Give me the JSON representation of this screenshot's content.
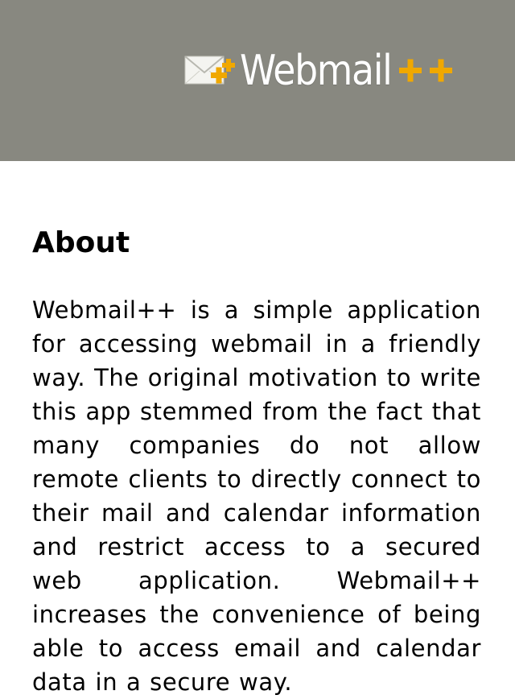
{
  "header": {
    "logo_text": "Webmail",
    "logo_accent": "++",
    "background_color": "#888880",
    "accent_color": "#f0a800",
    "icon": "envelope-plus-icon"
  },
  "about": {
    "title": "About",
    "body": "Webmail++ is a simple application for accessing webmail in a friendly way. The original motivation to write this app stemmed from the fact that many companies do not allow remote clients to directly connect to their mail and calendar information and restrict access to a secured web application. Webmail++ increases the convenience of being able to access email and calendar data in a secure way."
  }
}
